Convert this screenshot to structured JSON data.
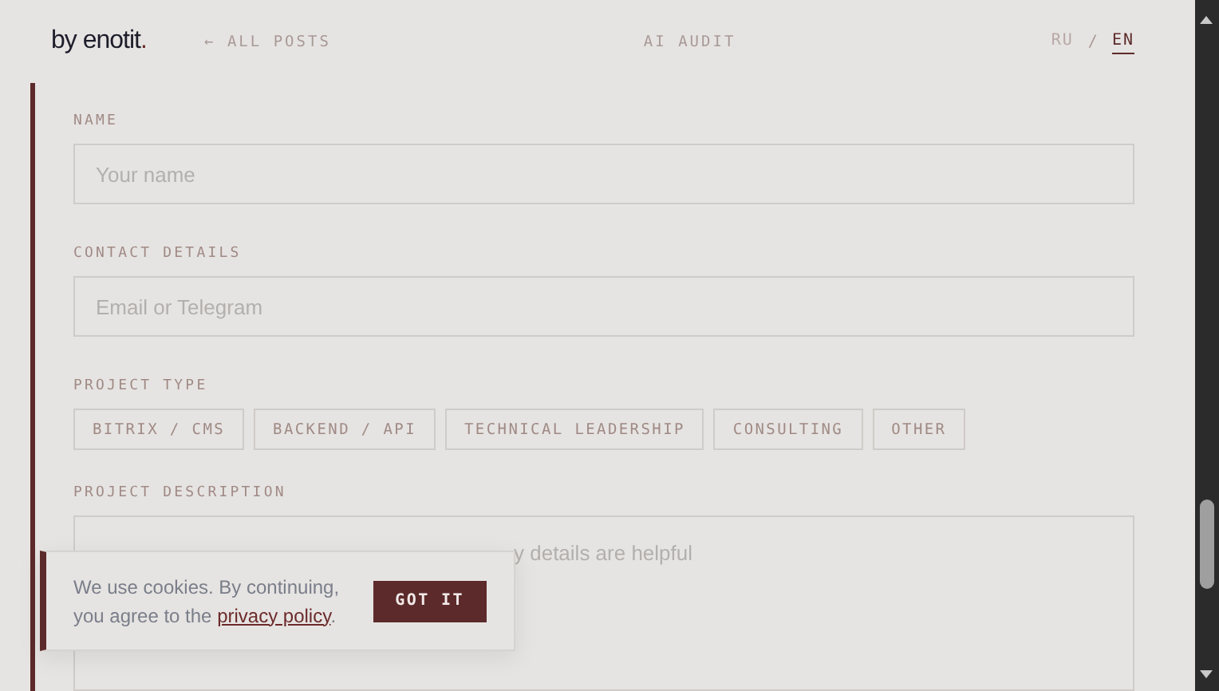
{
  "header": {
    "logo": {
      "text": "by enotit",
      "dot": "."
    },
    "back_link": "← ALL POSTS",
    "section": "AI AUDIT",
    "languages": [
      {
        "label": "RU",
        "selected": false
      },
      {
        "label": "EN",
        "selected": true
      }
    ],
    "separator": "/"
  },
  "form": {
    "name": {
      "label": "NAME",
      "placeholder": "Your name"
    },
    "contact": {
      "label": "CONTACT DETAILS",
      "placeholder": "Email or Telegram"
    },
    "project_type": {
      "label": "PROJECT TYPE",
      "options": [
        {
          "label": "BITRIX / CMS",
          "selected": false
        },
        {
          "label": "BACKEND / API",
          "selected": false
        },
        {
          "label": "TECHNICAL LEADERSHIP",
          "selected": false
        },
        {
          "label": "CONSULTING",
          "selected": false
        },
        {
          "label": "OTHER",
          "selected": false
        }
      ]
    },
    "description": {
      "label": "PROJECT DESCRIPTION",
      "placeholder_visible": "y details are helpful"
    }
  },
  "cookie_banner": {
    "text": "We use cookies. By continuing, you agree to the ",
    "link": "privacy policy",
    "end": ".",
    "button": "GOT IT"
  }
}
